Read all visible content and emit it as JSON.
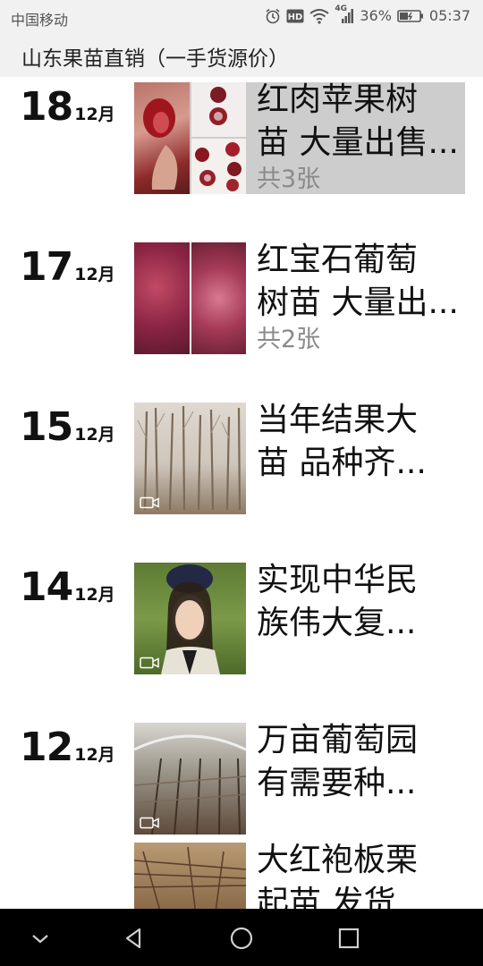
{
  "status_bar": {
    "carrier": "中国移动",
    "network": "4G",
    "battery": "36%",
    "time": "05:37"
  },
  "title_bar": {
    "title": "山东果苗直销（一手货源价）"
  },
  "posts": [
    {
      "day": "18",
      "month": "12月",
      "line1": "红肉苹果树",
      "line2": "苗 大量出售...",
      "count_label": "共3张",
      "highlighted": true
    },
    {
      "day": "17",
      "month": "12月",
      "line1": "红宝石葡萄",
      "line2": "树苗 大量出...",
      "count_label": "共2张"
    },
    {
      "day": "15",
      "month": "12月",
      "line1": "当年结果大",
      "line2": "苗 品种齐..."
    },
    {
      "day": "14",
      "month": "12月",
      "line1": "实现中华民",
      "line2": "族伟大复..."
    },
    {
      "day": "12",
      "month": "12月",
      "line1": "万亩葡萄园",
      "line2": "有需要种..."
    },
    {
      "line1": "大红袍板栗",
      "line2": "起苗 发货"
    }
  ],
  "icons": {
    "status": [
      "alarm-icon",
      "hd-icon",
      "wifi-icon",
      "signal-icon",
      "battery-icon"
    ],
    "nav": [
      "collapse-chevron-icon",
      "back-triangle-icon",
      "home-circle-icon",
      "recents-square-icon"
    ],
    "video": "video-camera-icon"
  },
  "colors": {
    "highlight": "#cdcdcd",
    "bar_bg": "#f1f1f1",
    "count_text": "#8a8a8a",
    "navbar": "#000000"
  }
}
